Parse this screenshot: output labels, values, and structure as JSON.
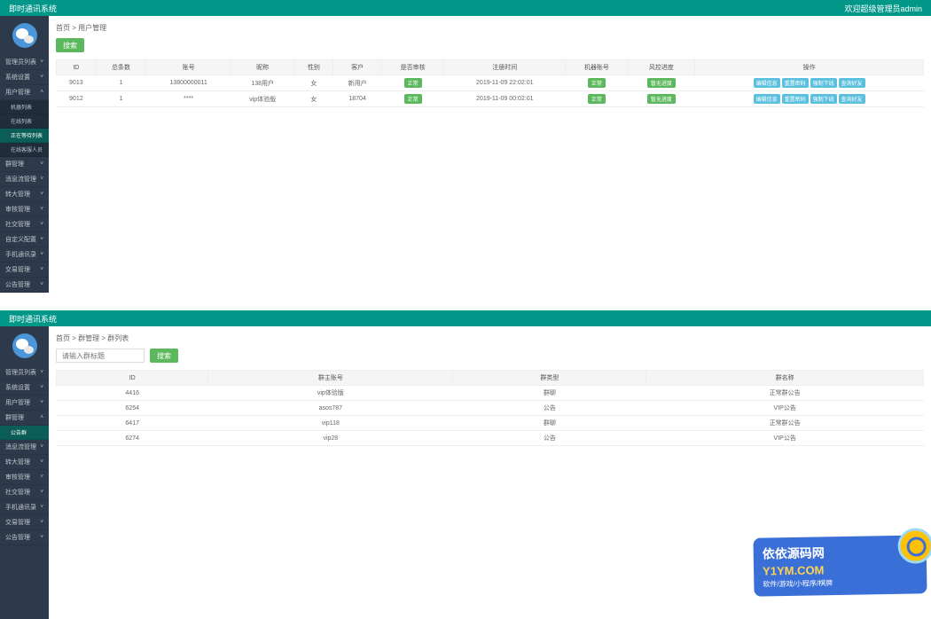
{
  "app1": {
    "title": "即时通讯系统",
    "welcome": "欢迎超级管理员admin",
    "nav": [
      {
        "label": "管理员列表",
        "sub": false
      },
      {
        "label": "系统设置",
        "sub": false
      },
      {
        "label": "用户管理",
        "sub": false,
        "open": true
      },
      {
        "label": "机器列表",
        "sub": true
      },
      {
        "label": "在线列表",
        "sub": true
      },
      {
        "label": "正在等待列表",
        "sub": true,
        "active": true
      },
      {
        "label": "在线客服人员",
        "sub": true
      },
      {
        "label": "群管理",
        "sub": false
      },
      {
        "label": "消息流管理",
        "sub": false
      },
      {
        "label": "转大管理",
        "sub": false
      },
      {
        "label": "审核管理",
        "sub": false
      },
      {
        "label": "社交管理",
        "sub": false
      },
      {
        "label": "自定义配置",
        "sub": false
      },
      {
        "label": "手机通讯录",
        "sub": false
      },
      {
        "label": "交易管理",
        "sub": false
      },
      {
        "label": "公告管理",
        "sub": false
      }
    ],
    "breadcrumb": "首页 > 用户管理",
    "search_btn": "搜索",
    "table": {
      "headers": [
        "ID",
        "总条数",
        "账号",
        "昵称",
        "性别",
        "客户",
        "是否审核",
        "注册时间",
        "机器账号",
        "风控进度",
        "操作"
      ],
      "rows": [
        {
          "id": "9013",
          "count": "1",
          "acct": "13800000011",
          "nick": "138用户",
          "sex": "女",
          "cust": "新用户",
          "audit": "正常",
          "time": "2019-11-09 22:02:01",
          "device": "正常",
          "risk": "暂无进度",
          "ops": [
            "编辑信息",
            "重置密码",
            "强制下线",
            "查询好友"
          ]
        },
        {
          "id": "9012",
          "count": "1",
          "acct": "****",
          "nick": "vip体验版",
          "sex": "女",
          "cust": "18704",
          "audit": "正常",
          "time": "2019-11-09 00:02:01",
          "device": "正常",
          "risk": "暂无进度",
          "ops": [
            "编辑信息",
            "重置密码",
            "强制下线",
            "查询好友"
          ]
        }
      ]
    }
  },
  "app2": {
    "title": "即时通讯系统",
    "nav": [
      {
        "label": "管理员列表",
        "sub": false
      },
      {
        "label": "系统设置",
        "sub": false
      },
      {
        "label": "用户管理",
        "sub": false
      },
      {
        "label": "群管理",
        "sub": false,
        "open": true
      },
      {
        "label": "公告群",
        "sub": true,
        "active": true
      },
      {
        "label": "消息流管理",
        "sub": false
      },
      {
        "label": "转大管理",
        "sub": false
      },
      {
        "label": "审核管理",
        "sub": false
      },
      {
        "label": "社交管理",
        "sub": false
      },
      {
        "label": "手机通讯录",
        "sub": false
      },
      {
        "label": "交易管理",
        "sub": false
      },
      {
        "label": "公告管理",
        "sub": false
      }
    ],
    "breadcrumb": "首页 > 群管理 > 群列表",
    "search_placeholder": "请输入群标题",
    "search_btn": "搜索",
    "table": {
      "headers": [
        "ID",
        "群主账号",
        "群类型",
        "群名称"
      ],
      "rows": [
        {
          "id": "4416",
          "owner": "vip体验版",
          "type": "群聊",
          "name": "正常群公告"
        },
        {
          "id": "6254",
          "owner": "asos787",
          "type": "公告",
          "name": "VIP公告"
        },
        {
          "id": "6417",
          "owner": "vip118",
          "type": "群聊",
          "name": "正常群公告"
        },
        {
          "id": "6274",
          "owner": "vip28",
          "type": "公告",
          "name": "VIP公告"
        }
      ]
    }
  },
  "badge": {
    "line1": "依依源码网",
    "line2": "Y1YM.COM",
    "line3": "软件/游戏/小程序/棋牌"
  }
}
